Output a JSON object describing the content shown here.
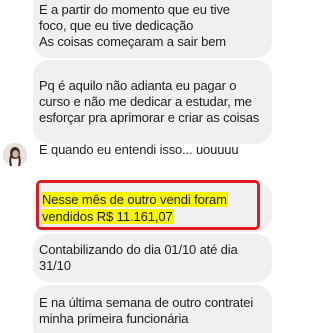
{
  "messages": [
    {
      "lines": [
        "E a partir do momento que eu tive",
        "foco, que eu tive dedicação",
        "As coisas começaram a sair bem"
      ]
    },
    {
      "lines": [
        "Pq é aquilo não adianta eu pagar o",
        "curso e não me dedicar a estudar, me",
        "esforçar pra aprimorar e criar as coisas",
        "",
        "E quando eu entendi isso... uouuuu"
      ]
    },
    {
      "lines": [
        "Nesse mês de outro vendi foram",
        "vendidos R$ 11.161,07"
      ],
      "highlight_color": "#f8f500",
      "box_color": "#e01820"
    },
    {
      "lines": [
        "Contabilizando do dia 01/10 até dia",
        "31/10"
      ]
    },
    {
      "lines": [
        "E na última semana de outro contratei",
        "minha primeira funcionária"
      ]
    }
  ],
  "colors": {
    "bubble_bg": "#f0f0f0",
    "text": "#1c1e21"
  },
  "icons": {
    "avatar": "contact-avatar-photo"
  }
}
